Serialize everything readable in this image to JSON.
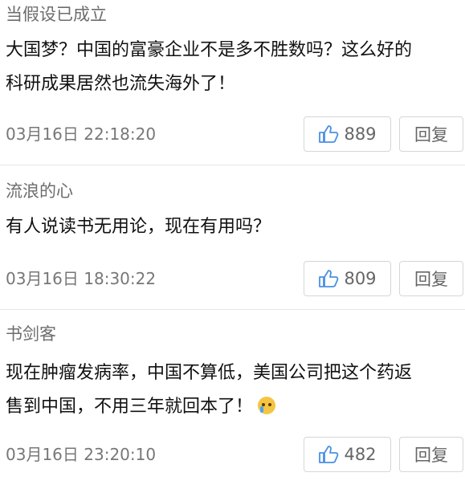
{
  "comments": [
    {
      "author": "当假设已成立",
      "text_lines": [
        "大国梦？中国的富豪企业不是多不胜数吗？这么好的",
        "科研成果居然也流失海外了！"
      ],
      "time": "03月16日 22:18:20",
      "likes": "889",
      "reply_label": "回复"
    },
    {
      "author": "流浪的心",
      "text_lines": [
        "有人说读书无用论，现在有用吗？"
      ],
      "time": "03月16日 18:30:22",
      "likes": "809",
      "reply_label": "回复"
    },
    {
      "author": "书剑客",
      "text_lines": [
        "现在肿瘤发病率，中国不算低，美国公司把这个药返",
        "售到中国，不用三年就回本了！"
      ],
      "time": "03月16日 23:20:10",
      "likes": "482",
      "reply_label": "回复"
    }
  ],
  "icons": {
    "like": "thumbs-up-icon",
    "emoji": "crying-face-icon"
  },
  "colors": {
    "accent": "#4a90e2",
    "meta_text": "#777777",
    "divider": "#e6e6e6"
  }
}
